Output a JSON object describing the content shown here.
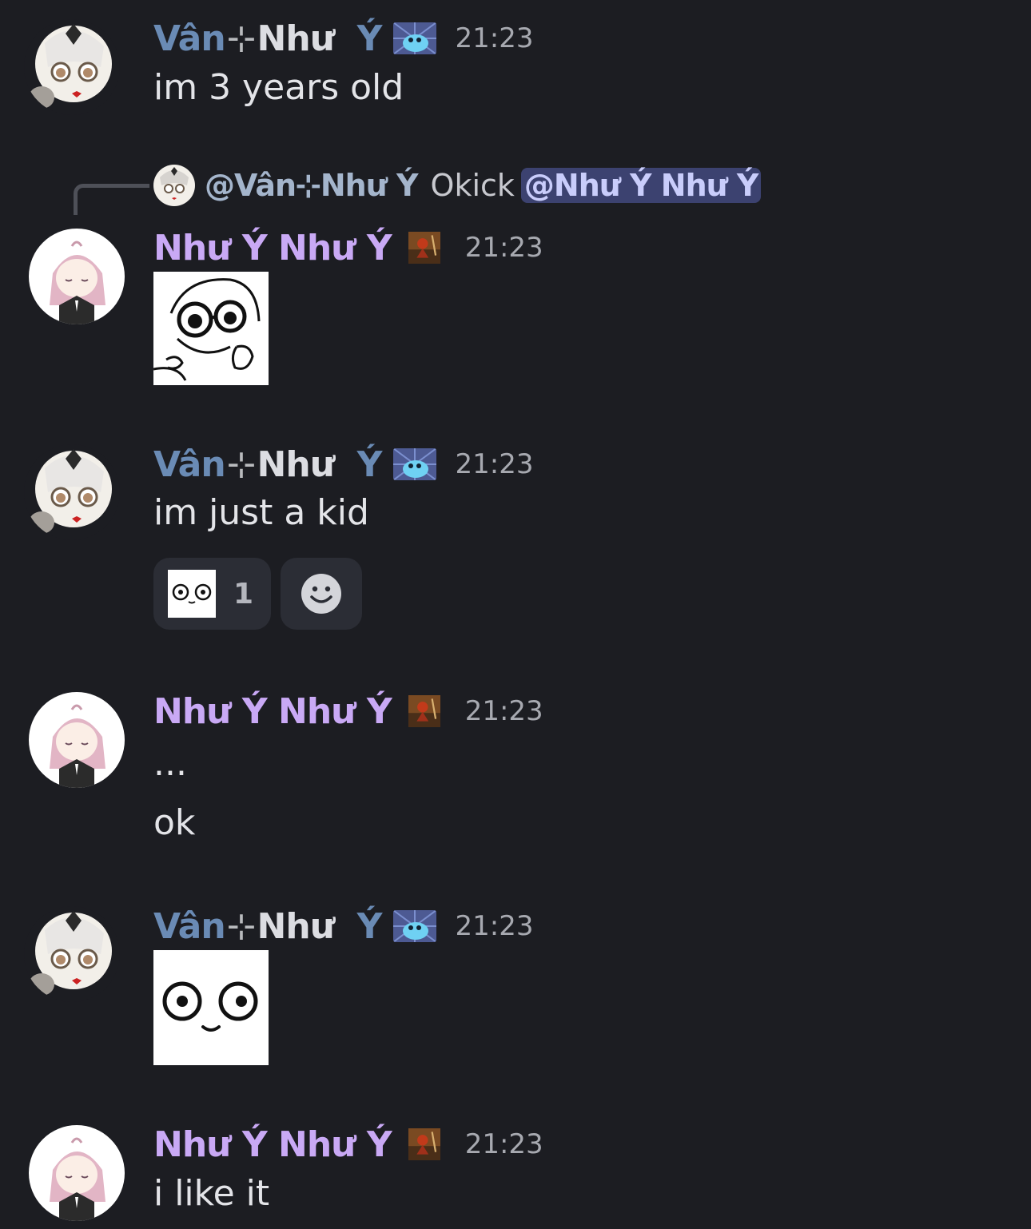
{
  "users": {
    "van": {
      "name_part1": "Vân",
      "name_sym": "⊹",
      "name_part2": "Như",
      "name_part3": "Ý"
    },
    "nhu": {
      "name_part1": "Như",
      "name_part2": "Ý",
      "name_part3": "Như",
      "name_part4": "Ý"
    }
  },
  "messages": [
    {
      "author": "van",
      "time": "21:23",
      "text": "im 3 years old"
    },
    {
      "author": "nhu",
      "time": "21:23",
      "reply": {
        "name": "@Vân⊹Như  Ý",
        "text": "Okick",
        "mention": "@Như Ý Như Ý"
      },
      "sticker": "shocked-glasses-sticker"
    },
    {
      "author": "van",
      "time": "21:23",
      "text": "im just a kid",
      "reactions": [
        {
          "emoji": "stare-face-emoji",
          "count": "1"
        }
      ],
      "add_reaction": "add-reaction-icon"
    },
    {
      "author": "nhu",
      "time": "21:23",
      "text": "...",
      "text2": "ok"
    },
    {
      "author": "van",
      "time": "21:23",
      "sticker": "stare-face-sticker"
    },
    {
      "author": "nhu",
      "time": "21:23",
      "text": "i  like it"
    }
  ],
  "colors": {
    "background": "#1c1d22",
    "van_name": "#6a8bb5",
    "nhu_name": "#c9a9f5",
    "mention_bg": "#3c4270",
    "reaction_bg": "#2b2d35"
  }
}
